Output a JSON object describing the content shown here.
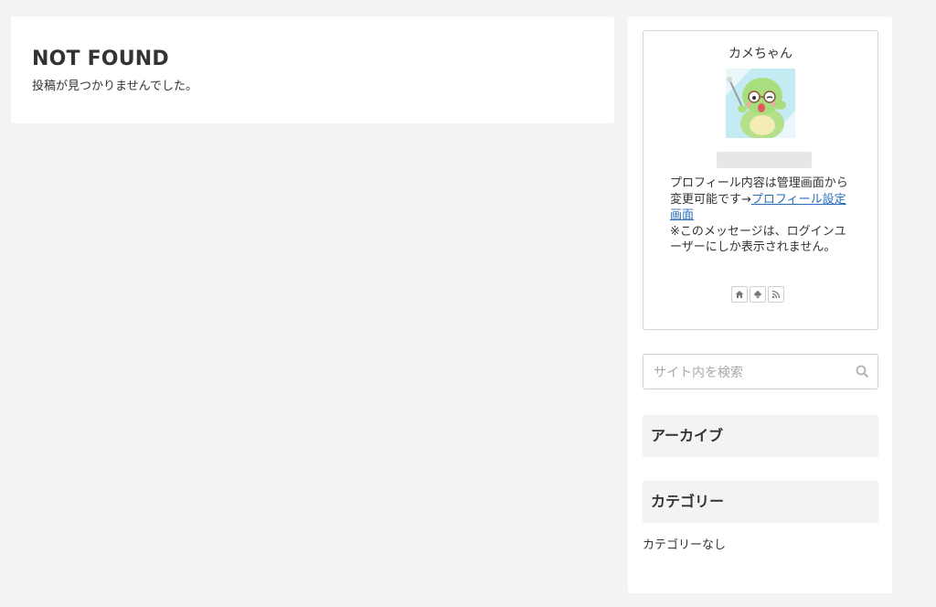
{
  "main": {
    "title": "NOT FOUND",
    "message": "投稿が見つかりませんでした。"
  },
  "sidebar": {
    "profile": {
      "name": "カメちゃん",
      "avatar_icon": "turtle-avatar",
      "desc_text": "プロフィール内容は管理画面から変更可能です→",
      "desc_link": "プロフィール設定画面",
      "desc_note": "※このメッセージは、ログインユーザーにしか表示されません。",
      "social_icons": [
        "home-icon",
        "feedly-icon",
        "rss-icon"
      ]
    },
    "search": {
      "placeholder": "サイト内を検索"
    },
    "archive_title": "アーカイブ",
    "category_title": "カテゴリー",
    "category_empty": "カテゴリーなし"
  }
}
